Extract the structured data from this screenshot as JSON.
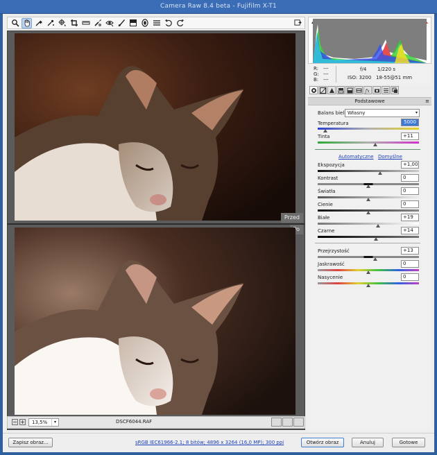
{
  "window": {
    "title": "Camera Raw 8.4 beta  -  Fujifilm X-T1"
  },
  "toolbar": {
    "tools": [
      "zoom-icon",
      "hand-icon",
      "white-balance-icon",
      "color-sampler-icon",
      "targeted-adjustment-icon",
      "crop-icon",
      "straighten-icon",
      "spot-removal-icon",
      "red-eye-icon",
      "adjustment-brush-icon",
      "graduated-filter-icon",
      "radial-filter-icon",
      "preferences-icon",
      "rotate-ccw-icon",
      "rotate-cw-icon"
    ],
    "active_tool": "hand-icon"
  },
  "preview": {
    "before_label": "Przed",
    "after_label": "Po",
    "zoom": "13,5%",
    "filename": "DSCF6044.RAF"
  },
  "info": {
    "r_label": "R:",
    "g_label": "G:",
    "b_label": "B:",
    "r_value": "---",
    "g_value": "---",
    "b_value": "---",
    "aperture": "f/4",
    "shutter": "1/220 s",
    "iso": "ISO: 3200",
    "lens": "18-55@51 mm"
  },
  "panel": {
    "title": "Podstawowe",
    "white_balance_label": "Balans bieli:",
    "white_balance_value": "Własny",
    "temperature_label": "Temperatura",
    "temperature_value": "5000",
    "tint_label": "Tinta",
    "tint_value": "+11",
    "auto_link": "Automatyczne",
    "default_link": "Domyślne",
    "exposure_label": "Ekspozycja",
    "exposure_value": "+1,00",
    "contrast_label": "Kontrast",
    "contrast_value": "0",
    "highlights_label": "Światła",
    "highlights_value": "0",
    "shadows_label": "Cienie",
    "shadows_value": "0",
    "whites_label": "Białe",
    "whites_value": "+19",
    "blacks_label": "Czarne",
    "blacks_value": "+14",
    "clarity_label": "Przejrzystość",
    "clarity_value": "+13",
    "vibrance_label": "Jaskrawość",
    "vibrance_value": "0",
    "saturation_label": "Nasycenie",
    "saturation_value": "0"
  },
  "footer": {
    "save_button": "Zapisz obraz...",
    "workflow_link": "sRGB IEC61966-2.1; 8 bitów; 4896 x 3264 (16,0 MP); 300 ppi",
    "open_button": "Otwórz obraz",
    "cancel_button": "Anuluj",
    "done_button": "Gotowe"
  },
  "colors": {
    "accent": "#3c78d8",
    "link": "#1a3fb8",
    "title_bar": "#3a6db5"
  }
}
